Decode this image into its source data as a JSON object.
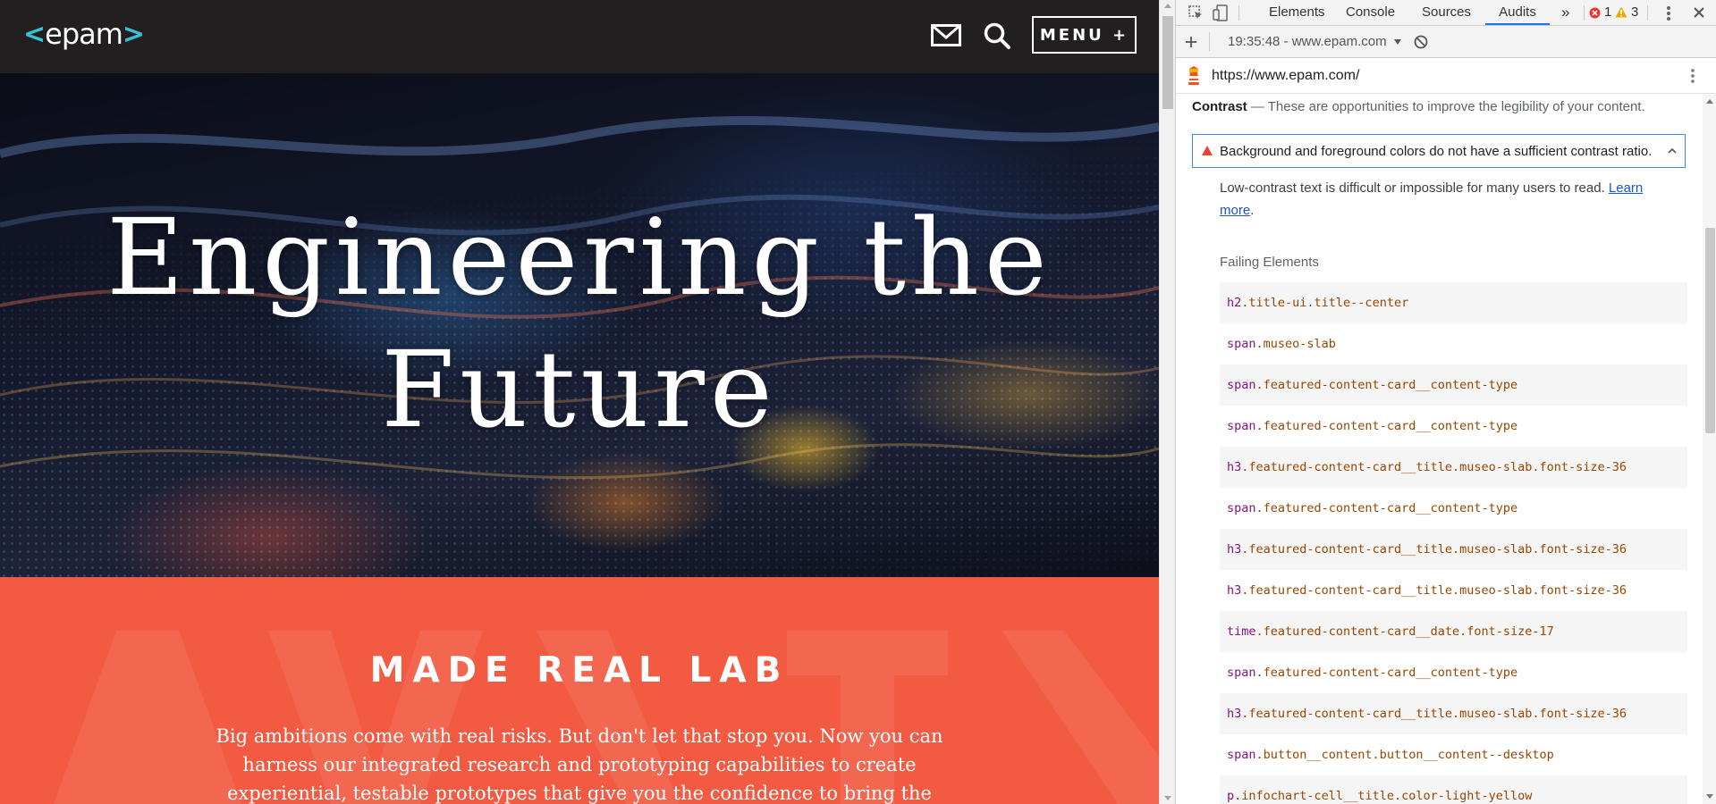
{
  "site": {
    "logo_text": "epam",
    "logo_left": "<",
    "logo_right": ">",
    "menu_label": "MENU +",
    "hero_title_line1": "Engineering the",
    "hero_title_line2": "Future",
    "lab_title": "MADE REAL LAB",
    "lab_text": "Big ambitions come with real risks. But don't let that stop you. Now you can harness our integrated research and prototyping capabilities to create experiential, testable prototypes that give you the confidence to bring the",
    "colors": {
      "header": "#231f20",
      "accent": "#39c2d7",
      "lab_bg": "#f25a41"
    }
  },
  "devtools": {
    "tabs": [
      "Elements",
      "Console",
      "Sources",
      "Audits"
    ],
    "active_tab": "Audits",
    "more_tabs": "»",
    "error_count": "1",
    "warning_count": "3",
    "report_label": "19:35:48 - www.epam.com",
    "url": "https://www.epam.com/",
    "contrast_heading": "Contrast",
    "contrast_subtitle": "— These are opportunities to improve the legibility of your content.",
    "audit_title": "Background and foreground colors do not have a sufficient contrast ratio.",
    "audit_desc": "Low-contrast text is difficult or impossible for many users to read.",
    "learn_more": "Learn more",
    "failing_title": "Failing Elements",
    "failing_elements": [
      {
        "tag": "h2",
        "cls": ".title-ui.title--center"
      },
      {
        "tag": "span",
        "cls": ".museo-slab"
      },
      {
        "tag": "span",
        "cls": ".featured-content-card__content-type"
      },
      {
        "tag": "span",
        "cls": ".featured-content-card__content-type"
      },
      {
        "tag": "h3",
        "cls": ".featured-content-card__title.museo-slab.font-size-36"
      },
      {
        "tag": "span",
        "cls": ".featured-content-card__content-type"
      },
      {
        "tag": "h3",
        "cls": ".featured-content-card__title.museo-slab.font-size-36"
      },
      {
        "tag": "h3",
        "cls": ".featured-content-card__title.museo-slab.font-size-36"
      },
      {
        "tag": "time",
        "cls": ".featured-content-card__date.font-size-17"
      },
      {
        "tag": "span",
        "cls": ".featured-content-card__content-type"
      },
      {
        "tag": "h3",
        "cls": ".featured-content-card__title.museo-slab.font-size-36"
      },
      {
        "tag": "span",
        "cls": ".button__content.button__content--desktop"
      },
      {
        "tag": "p",
        "cls": ".infochart-cell__title.color-light-yellow"
      }
    ]
  }
}
